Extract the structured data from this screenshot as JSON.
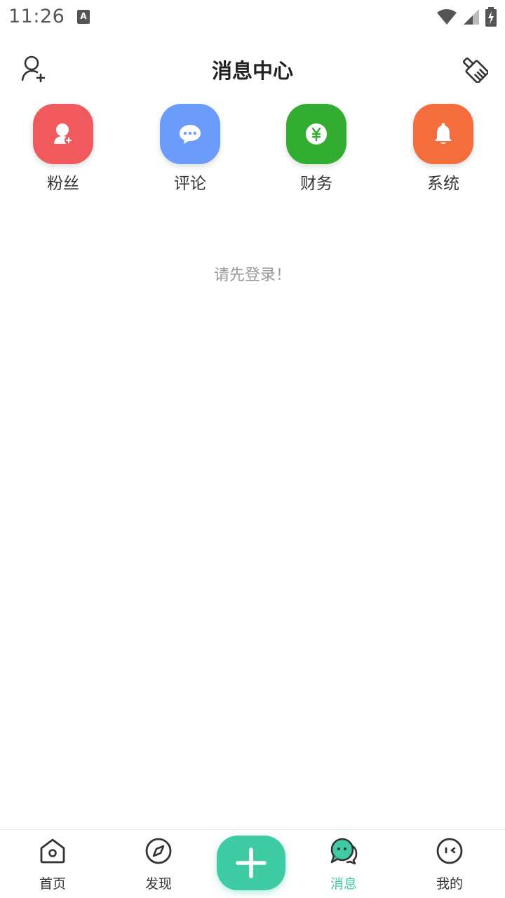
{
  "status_bar": {
    "time": "11:26",
    "notification_icon": "A"
  },
  "header": {
    "title": "消息中心"
  },
  "categories": [
    {
      "label": "粉丝",
      "icon": "person-add-icon",
      "color": "#f05a5f"
    },
    {
      "label": "评论",
      "icon": "chat-bubble-icon",
      "color": "#6b9bfb"
    },
    {
      "label": "财务",
      "icon": "yen-coin-icon",
      "color": "#32ad32"
    },
    {
      "label": "系统",
      "icon": "bell-icon",
      "color": "#f46d3c"
    }
  ],
  "empty_state": {
    "message": "请先登录！"
  },
  "bottom_nav": {
    "items": [
      {
        "label": "首页",
        "icon": "home-icon"
      },
      {
        "label": "发现",
        "icon": "compass-icon"
      },
      {
        "label": "消息",
        "icon": "message-icon",
        "active": true
      },
      {
        "label": "我的",
        "icon": "profile-face-icon"
      }
    ],
    "fab_icon": "plus-icon",
    "accent": "#3fcca5"
  }
}
